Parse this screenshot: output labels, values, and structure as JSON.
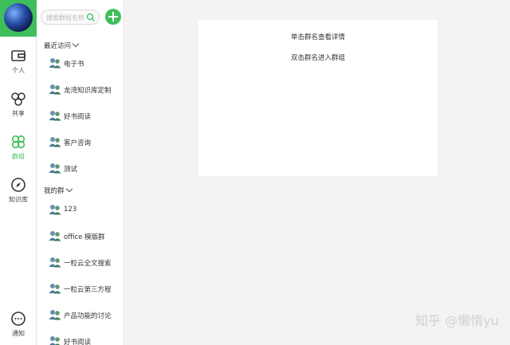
{
  "rail": {
    "items": [
      {
        "label": "个人",
        "icon": "wallet-icon"
      },
      {
        "label": "共享",
        "icon": "share-circles-icon"
      },
      {
        "label": "群组",
        "icon": "group-icon"
      },
      {
        "label": "知识库",
        "icon": "compass-icon"
      },
      {
        "label": "通知",
        "icon": "chat-bubble-icon"
      }
    ],
    "active_index": 2
  },
  "search": {
    "placeholder": "搜索群组名称"
  },
  "sections": {
    "recent": {
      "title": "最近访问"
    },
    "mine": {
      "title": "我的群"
    }
  },
  "recent_groups": [
    "电子书",
    "龙湾知识库定制",
    "好书阅读",
    "客户咨询",
    "测试"
  ],
  "my_groups": [
    "123",
    "office 模版群",
    "一粒云全文搜索",
    "一粒云第三方程",
    "产品功能的讨论",
    "好书阅读"
  ],
  "main": {
    "hint_click": "单击群名查看详情",
    "hint_dblclick": "双击群名进入群组"
  },
  "watermark": "知乎 @懒惰yu",
  "colors": {
    "accent": "#3fbf5b"
  }
}
